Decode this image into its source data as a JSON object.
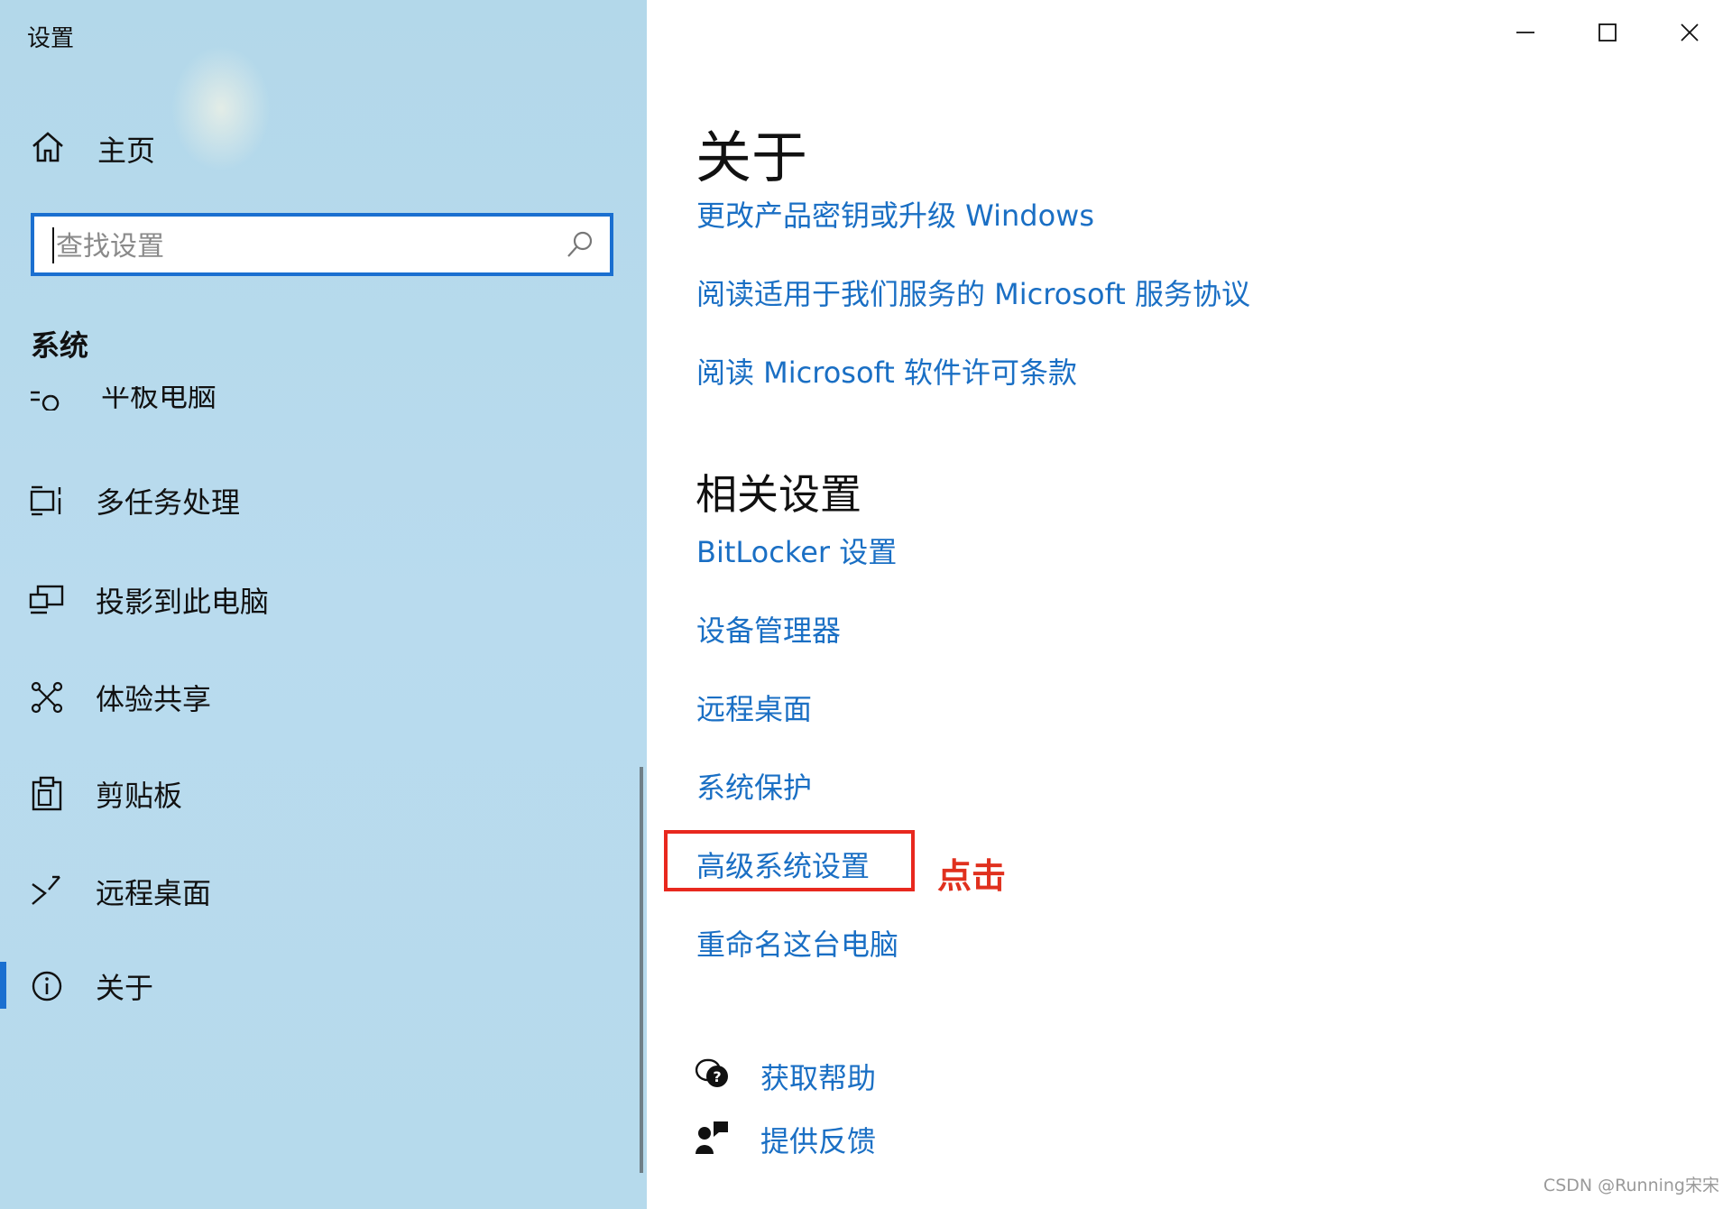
{
  "window": {
    "title": "设置"
  },
  "sidebar": {
    "home_label": "主页",
    "search_placeholder": "查找设置",
    "section_title": "系统",
    "clipped_item_label": "平板电脑",
    "items": [
      {
        "label": "多任务处理",
        "icon": "multitasking-icon"
      },
      {
        "label": "投影到此电脑",
        "icon": "project-icon"
      },
      {
        "label": "体验共享",
        "icon": "share-icon"
      },
      {
        "label": "剪贴板",
        "icon": "clipboard-icon"
      },
      {
        "label": "远程桌面",
        "icon": "remote-desktop-icon"
      },
      {
        "label": "关于",
        "icon": "info-icon",
        "selected": true
      }
    ]
  },
  "main": {
    "title": "关于",
    "links": [
      "更改产品密钥或升级 Windows",
      "阅读适用于我们服务的 Microsoft 服务协议",
      "阅读 Microsoft 软件许可条款"
    ],
    "related_title": "相关设置",
    "related_links": [
      "BitLocker 设置",
      "设备管理器",
      "远程桌面",
      "系统保护",
      "高级系统设置",
      "重命名这台电脑"
    ],
    "annotation": "点击",
    "help": {
      "get_help": "获取帮助",
      "feedback": "提供反馈"
    }
  },
  "watermark": "CSDN @Running宋宋",
  "colors": {
    "accent": "#1a6fd0",
    "link": "#1a6fc4",
    "highlight": "#e8281e",
    "sidebar_bg": "#b5d9ec"
  }
}
